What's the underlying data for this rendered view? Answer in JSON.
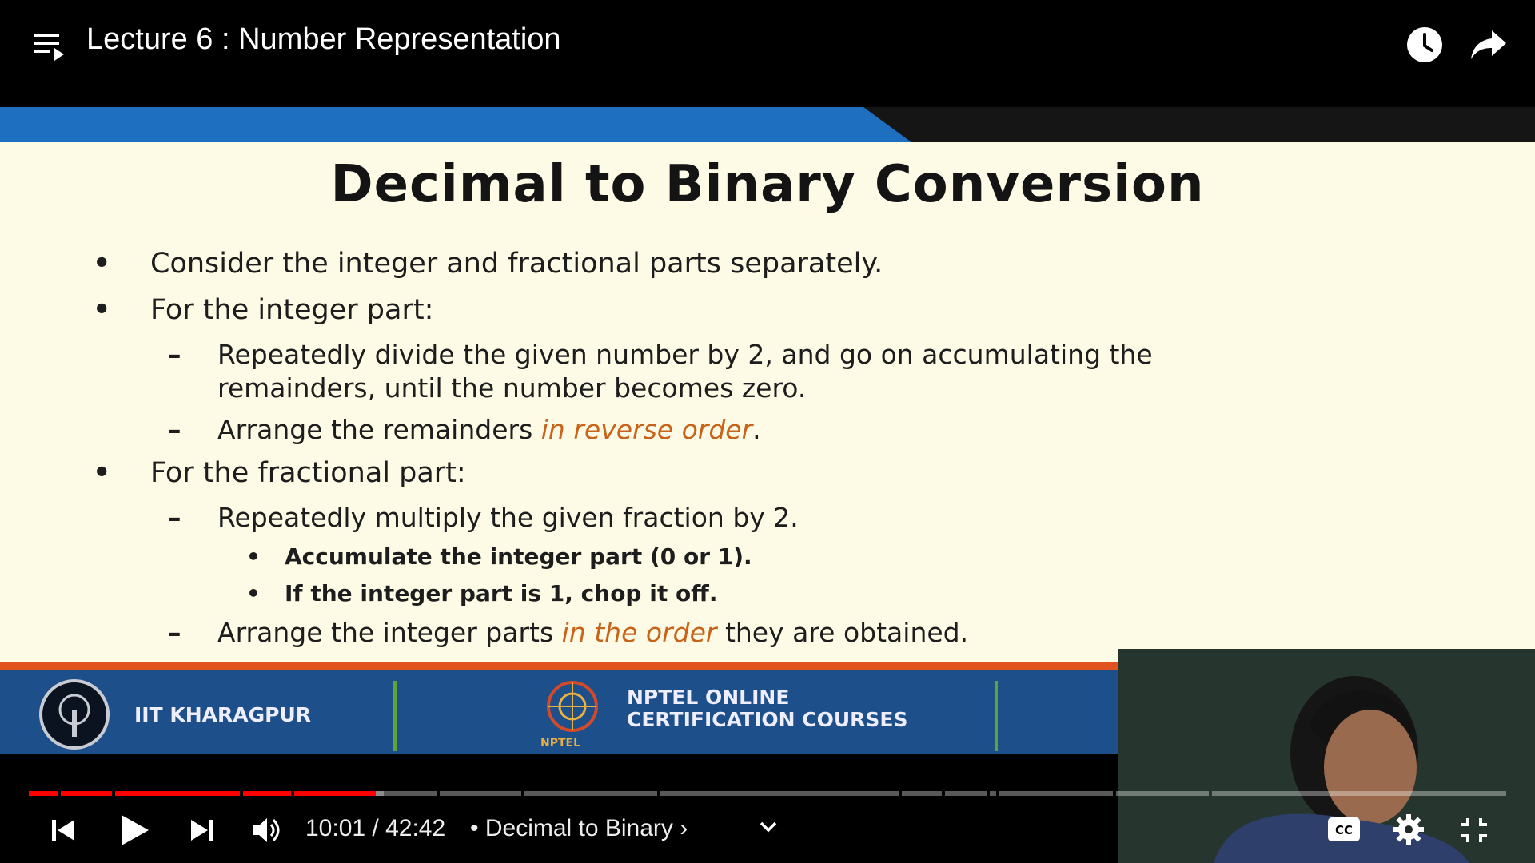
{
  "header": {
    "title": "Lecture 6 : Number Representation",
    "icons": [
      "playlist-icon",
      "clock-icon",
      "share-icon"
    ]
  },
  "slide": {
    "title": "Decimal to Binary Conversion",
    "bullets": {
      "b1": "Consider the integer and fractional parts separately.",
      "b2": "For the integer part:",
      "b2_d1_line1": "Repeatedly divide the given number by 2, and go on accumulating the",
      "b2_d1_line2": "remainders, until the number becomes zero.",
      "b2_d2_pre": "Arrange the remainders ",
      "b2_d2_hl": "in reverse order",
      "b2_d2_post": ".",
      "b3": "For the fractional part:",
      "b3_d1": "Repeatedly multiply the given fraction by 2.",
      "b3_d1_s1": "Accumulate the integer part (0 or 1).",
      "b3_d1_s2": "If the integer part is 1, chop it off.",
      "b3_d2_pre": "Arrange the integer parts ",
      "b3_d2_hl": "in the order",
      "b3_d2_post": " they are obtained."
    },
    "markers": {
      "bullet": "•",
      "dash": "–"
    },
    "footer": {
      "left": "IIT KHARAGPUR",
      "center_line1": "NPTEL ONLINE",
      "center_line2": "CERTIFICATION COURSES",
      "logo_caption": "NPTEL"
    }
  },
  "player": {
    "time": "10:01 / 42:42",
    "chapter": "• Decimal to Binary ›",
    "progress_played": 0.2349,
    "accent": "#ff0000",
    "controls": [
      "previous-icon",
      "play-icon",
      "next-icon",
      "volume-icon",
      "chevron-down-icon",
      "captions-icon",
      "gear-icon",
      "exit-fullscreen-icon"
    ],
    "captions_label": "CC"
  }
}
